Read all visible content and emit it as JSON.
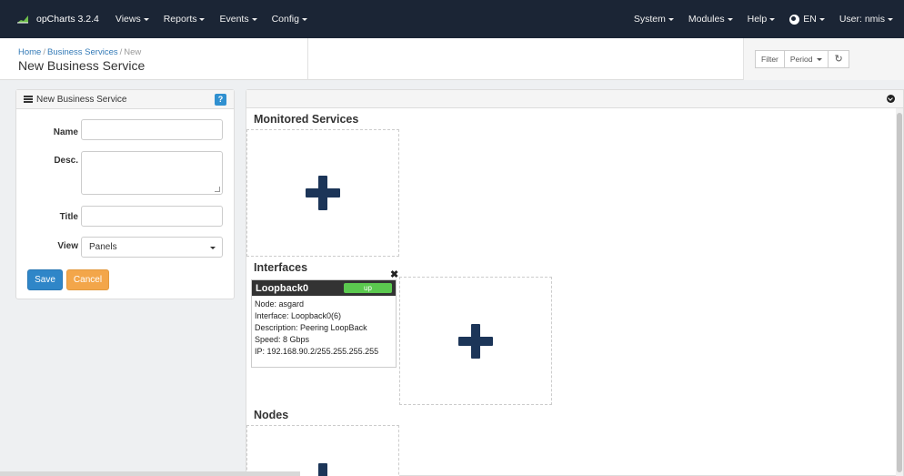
{
  "navbar": {
    "brand": "opCharts 3.2.4",
    "left_menu": [
      {
        "label": "Views",
        "icon": "caret-down-icon"
      },
      {
        "label": "Reports",
        "icon": "caret-down-icon"
      },
      {
        "label": "Events",
        "icon": "caret-down-icon"
      },
      {
        "label": "Config",
        "icon": "caret-down-icon"
      }
    ],
    "right_menu": [
      {
        "label": "System",
        "icon": "caret-down-icon"
      },
      {
        "label": "Modules",
        "icon": "caret-down-icon"
      },
      {
        "label": "Help",
        "icon": "caret-down-icon"
      },
      {
        "label": "EN",
        "icon": "globe-icon"
      },
      {
        "label": "User: nmis",
        "icon": "caret-down-icon"
      }
    ]
  },
  "header": {
    "breadcrumb": [
      "Home",
      "Business Services",
      "New"
    ],
    "title": "New Business Service",
    "tools": {
      "filter": "Filter",
      "period": "Period",
      "refresh_icon": "refresh-icon"
    }
  },
  "form": {
    "heading": "New Business Service",
    "help": "?",
    "fields": {
      "name": {
        "label": "Name",
        "value": ""
      },
      "desc": {
        "label": "Desc.",
        "value": ""
      },
      "title": {
        "label": "Title",
        "value": ""
      },
      "view": {
        "label": "View",
        "value": "Panels"
      }
    },
    "save": "Save",
    "cancel": "Cancel"
  },
  "main": {
    "sections": {
      "monitored": "Monitored Services",
      "interfaces": "Interfaces",
      "nodes": "Nodes"
    },
    "interface_card": {
      "name": "Loopback0",
      "status": "up",
      "lines": [
        "Node: asgard",
        "Interface: Loopback0(6)",
        "Description: Peering LoopBack",
        "Speed: 8 Gbps",
        "IP: 192.168.90.2/255.255.255.255"
      ]
    }
  },
  "colors": {
    "navbar_bg": "#1b2535",
    "plus": "#1c3558",
    "save": "#2f86c8",
    "cancel": "#f3a64a",
    "status_up": "#5bc94f"
  }
}
